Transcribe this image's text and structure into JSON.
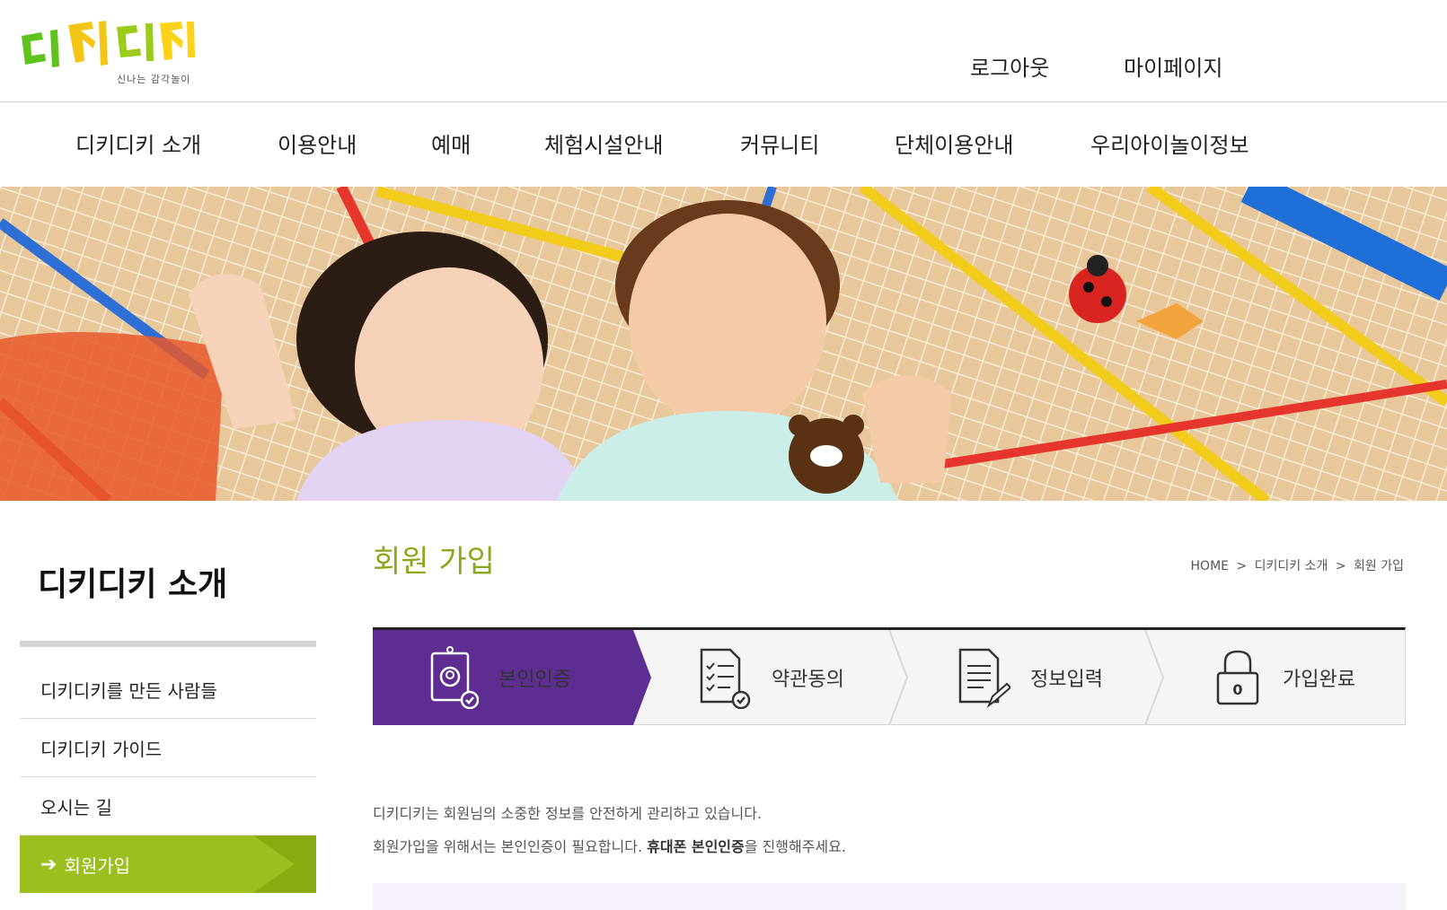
{
  "header": {
    "logo_text": "디키디키",
    "logo_sub": "신나는 감각놀이",
    "logout": "로그아웃",
    "mypage": "마이페이지"
  },
  "gnb": [
    "디키디키 소개",
    "이용안내",
    "예매",
    "체험시설안내",
    "커뮤니티",
    "단체이용안내",
    "우리아이놀이정보"
  ],
  "sidebar": {
    "title": "디키디키 소개",
    "items": [
      {
        "label": "디키디키를 만든 사람들"
      },
      {
        "label": "디키디키 가이드"
      },
      {
        "label": "오시는 길"
      },
      {
        "label": "회원가입"
      }
    ]
  },
  "main": {
    "title": "회원 가입",
    "breadcrumb": [
      "HOME",
      ">",
      "디키디키 소개",
      ">",
      "회원 가입"
    ],
    "steps": [
      {
        "label": "본인인증",
        "icon": "id-badge-check-icon"
      },
      {
        "label": "약관동의",
        "icon": "checklist-document-icon"
      },
      {
        "label": "정보입력",
        "icon": "document-pen-icon"
      },
      {
        "label": "가입완료",
        "icon": "lock-icon",
        "lock_text": "0"
      }
    ],
    "info_line1": "디키디키는 회원님의 소중한 정보를 안전하게 관리하고 있습니다.",
    "info_line2_pre": "회원가입을 위해서는 본인인증이 필요합니다. ",
    "info_line2_bold": "휴대폰 본인인증",
    "info_line2_post": "을 진행해주세요."
  },
  "colors": {
    "accent_green": "#9dbe1f",
    "title_green": "#8aa81b",
    "step_purple": "#5e2d91"
  }
}
